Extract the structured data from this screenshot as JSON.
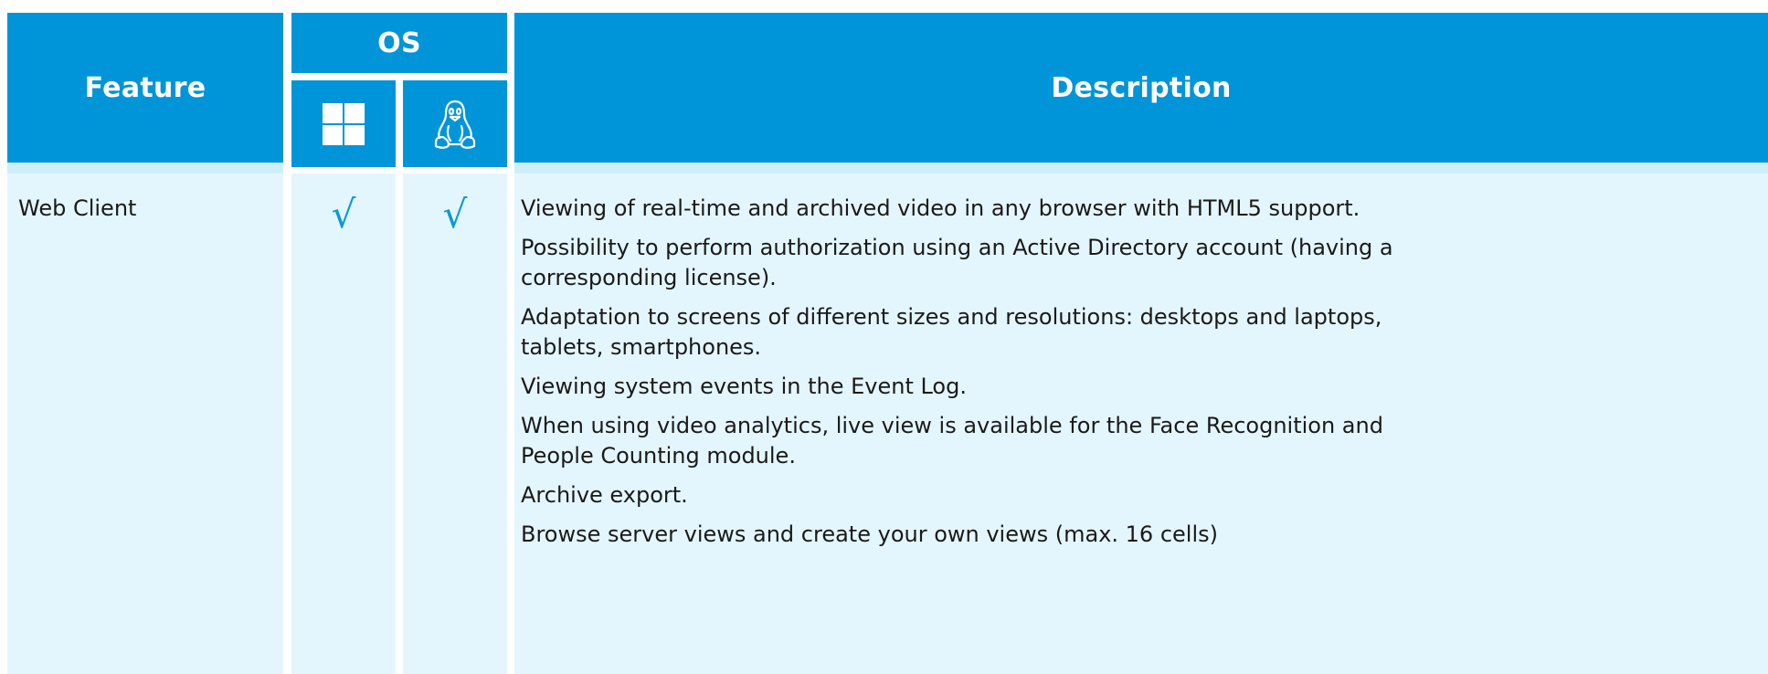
{
  "header": {
    "feature": "Feature",
    "os": "OS",
    "windows_icon": "windows-logo-icon",
    "linux_icon": "linux-tux-icon",
    "description": "Description"
  },
  "rows": [
    {
      "feature": "Web Client",
      "windows_check": "√",
      "linux_check": "√",
      "descriptions": [
        "Viewing of real-time and archived video in any browser with HTML5 support.",
        "Possibility to perform authorization using an Active Directory account (having a corresponding license).",
        "Adaptation to screens of different sizes and resolutions: desktops and laptops, tablets, smartphones.",
        "Viewing system events in the Event Log.",
        "When using video analytics, live view is available for the Face Recognition and People Counting module.",
        "Archive export.",
        "Browse server views and create your own views (max. 16 cells)"
      ]
    }
  ],
  "colors": {
    "header_bg": "#0095d9",
    "header_text": "#ffffff",
    "separator_bg": "#cfeefb",
    "row_bg": "#e4f6fd",
    "check_color": "#0a9ad8",
    "body_text": "#1a1a1a"
  }
}
